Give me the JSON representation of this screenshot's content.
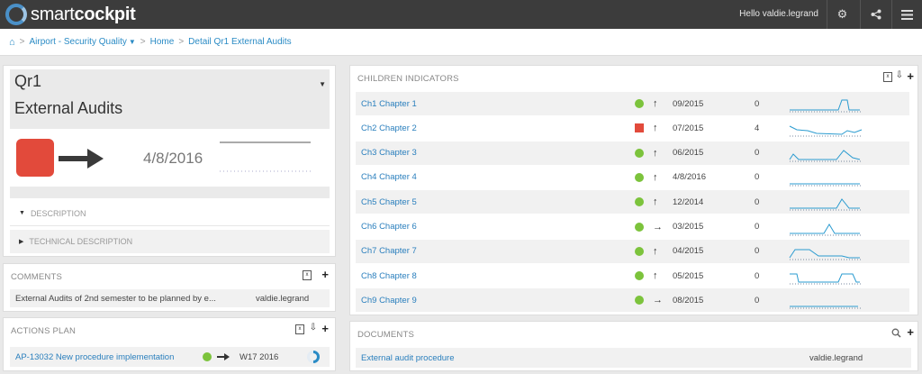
{
  "brand": {
    "light": "smart",
    "bold": "cockpit"
  },
  "header": {
    "greeting": "Hello valdie.legrand"
  },
  "breadcrumb": {
    "items": [
      "Airport - Security Quality",
      "Home",
      "Detail Qr1 External Audits"
    ]
  },
  "indicator": {
    "code": "Qr1",
    "title": "External Audits",
    "date": "4/8/2016",
    "status_color": "#e24a3b",
    "trend": "right",
    "sections": [
      "DESCRIPTION",
      "TECHNICAL DESCRIPTION"
    ]
  },
  "comments": {
    "title": "COMMENTS",
    "items": [
      {
        "text": "External Audits of 2nd semester to be planned by e...",
        "author": "valdie.legrand"
      }
    ]
  },
  "actions": {
    "title": "ACTIONS PLAN",
    "items": [
      {
        "name": "AP-13032 New procedure implementation",
        "trend": "right",
        "week": "W17 2016"
      }
    ]
  },
  "children": {
    "title": "CHILDREN INDICATORS",
    "rows": [
      {
        "name": "Ch1 Chapter 1",
        "status": "green",
        "trend": "up",
        "date": "09/2015",
        "value": "0"
      },
      {
        "name": "Ch2 Chapter 2",
        "status": "red",
        "trend": "up",
        "date": "07/2015",
        "value": "4"
      },
      {
        "name": "Ch3 Chapter 3",
        "status": "green",
        "trend": "up",
        "date": "06/2015",
        "value": "0"
      },
      {
        "name": "Ch4 Chapter 4",
        "status": "green",
        "trend": "up",
        "date": "4/8/2016",
        "value": "0"
      },
      {
        "name": "Ch5 Chapter 5",
        "status": "green",
        "trend": "up",
        "date": "12/2014",
        "value": "0"
      },
      {
        "name": "Ch6 Chapter 6",
        "status": "green",
        "trend": "right",
        "date": "03/2015",
        "value": "0"
      },
      {
        "name": "Ch7 Chapter 7",
        "status": "green",
        "trend": "up",
        "date": "04/2015",
        "value": "0"
      },
      {
        "name": "Ch8 Chapter 8",
        "status": "green",
        "trend": "up",
        "date": "05/2015",
        "value": "0"
      },
      {
        "name": "Ch9 Chapter 9",
        "status": "green",
        "trend": "right",
        "date": "08/2015",
        "value": "0"
      }
    ]
  },
  "documents": {
    "title": "DOCUMENTS",
    "items": [
      {
        "name": "External audit procedure",
        "author": "valdie.legrand"
      }
    ]
  },
  "colors": {
    "green": "#7cc33c",
    "red": "#e24a3b",
    "link": "#2a7fbd",
    "topbar": "#3c3c3c"
  }
}
